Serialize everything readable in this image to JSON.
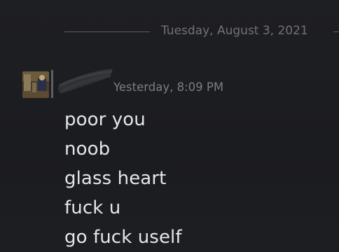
{
  "date_divider": {
    "label": "Tuesday, August 3, 2021"
  },
  "message_group": {
    "sender_name": "",
    "timestamp": "Yesterday, 8:09 PM",
    "messages": [
      "poor you",
      "noob",
      "glass heart",
      "fuck u",
      "go fuck uself"
    ]
  },
  "colors": {
    "background": "#1c1d21",
    "message_text": "#e5e6e8",
    "meta_text": "#7a7d83",
    "divider": "#5b5e64"
  }
}
